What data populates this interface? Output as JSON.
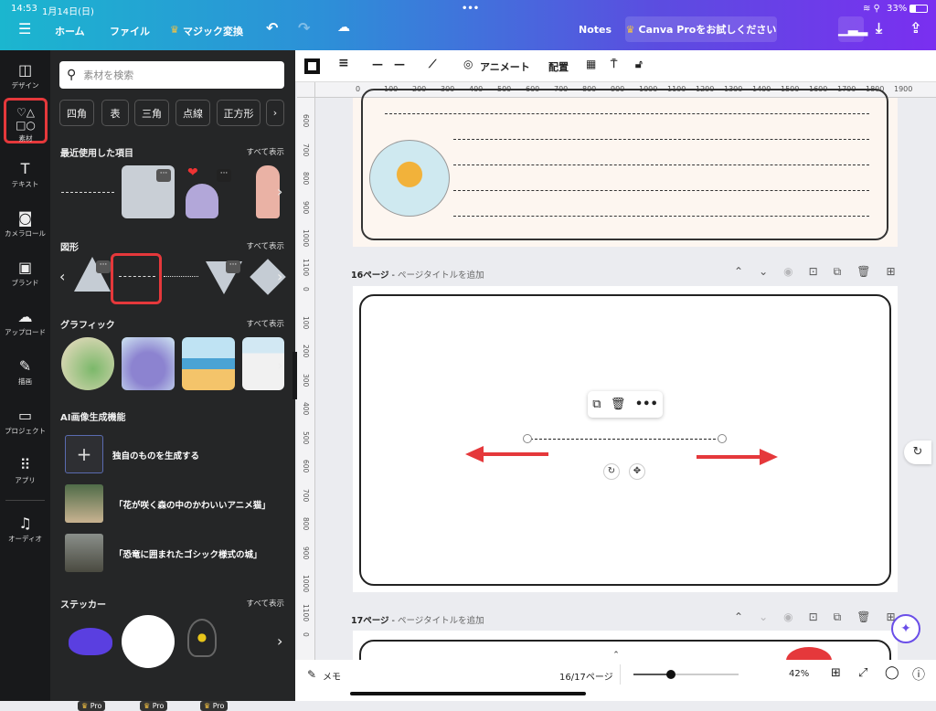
{
  "status": {
    "time": "14:53",
    "date": "1月14日(日)",
    "battery": "33%"
  },
  "topbar": {
    "menu_icon": "hamburger-icon",
    "home": "ホーム",
    "file": "ファイル",
    "magic": "マジック変換",
    "notes": "Notes",
    "pro": "Canva Proをお試しください"
  },
  "rail": [
    {
      "label": "デザイン",
      "icon": "layout-icon"
    },
    {
      "label": "素材",
      "icon": "elements-icon"
    },
    {
      "label": "テキスト",
      "icon": "text-icon"
    },
    {
      "label": "カメラロール",
      "icon": "camera-icon"
    },
    {
      "label": "ブランド",
      "icon": "brand-icon"
    },
    {
      "label": "アップロード",
      "icon": "upload-icon"
    },
    {
      "label": "描画",
      "icon": "draw-icon"
    },
    {
      "label": "プロジェクト",
      "icon": "folder-icon"
    },
    {
      "label": "アプリ",
      "icon": "apps-icon"
    },
    {
      "label": "オーディオ",
      "icon": "audio-icon"
    }
  ],
  "panel": {
    "search_placeholder": "素材を検索",
    "chips": [
      "四角",
      "表",
      "三角",
      "点線",
      "正方形"
    ],
    "recent": "最近使用した項目",
    "shapes": "図形",
    "graphics": "グラフィック",
    "ai": "AI画像生成機能",
    "ai_items": [
      "独自のものを生成する",
      "「花が咲く森の中のかわいいアニメ猫」",
      "「恐竜に囲まれたゴシック様式の城」"
    ],
    "stickers": "ステッカー",
    "see_all": "すべて表示",
    "pro": "Pro"
  },
  "toolbar": {
    "animate": "アニメート",
    "position": "配置"
  },
  "ruler_h": [
    "0",
    "100",
    "200",
    "300",
    "400",
    "500",
    "600",
    "700",
    "800",
    "900",
    "1000",
    "1100",
    "1200",
    "1300",
    "1400",
    "1500",
    "1600",
    "1700",
    "1800",
    "1900"
  ],
  "ruler_v": [
    "600",
    "700",
    "800",
    "900",
    "1000",
    "1100",
    "0",
    "100",
    "200",
    "300",
    "400",
    "500",
    "600",
    "700",
    "800",
    "900",
    "1000",
    "1100",
    "0"
  ],
  "pages": [
    {
      "num": "16ページ",
      "title": "ページタイトルを追加"
    },
    {
      "num": "17ページ",
      "title": "ページタイトルを追加"
    }
  ],
  "bottom": {
    "notes": "メモ",
    "page": "16/17ページ",
    "zoom": "42%",
    "zoom_level": 0.36
  },
  "colors": {
    "accent_red": "#e5383b",
    "panel": "#252627"
  }
}
